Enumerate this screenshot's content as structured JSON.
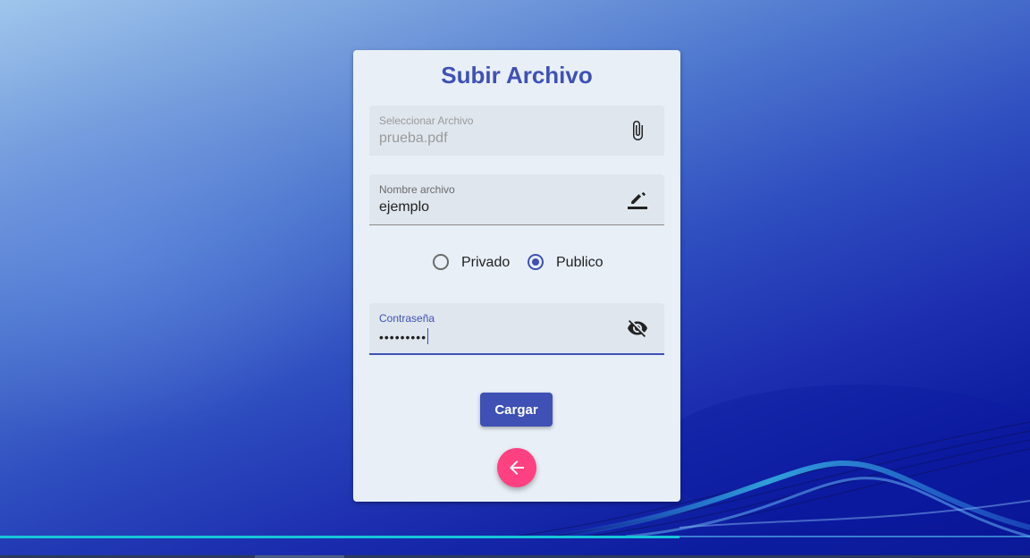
{
  "colors": {
    "primary": "#3f51b5",
    "accent": "#ff4081",
    "card_bg": "#e8eff7",
    "field_bg": "#dfe6ee"
  },
  "dialog": {
    "title": "Subir Archivo",
    "file_field": {
      "label": "Seleccionar Archivo",
      "value": "prueba.pdf",
      "icon": "paperclip-icon",
      "disabled": true
    },
    "name_field": {
      "label": "Nombre archivo",
      "value": "ejemplo",
      "icon": "pencil-icon"
    },
    "visibility": {
      "options": [
        {
          "label": "Privado",
          "checked": false
        },
        {
          "label": "Publico",
          "checked": true
        }
      ]
    },
    "password_field": {
      "label": "Contraseña",
      "value": "•••••••••",
      "icon": "eye-off-icon",
      "focused": true
    },
    "submit_label": "Cargar",
    "back_icon": "arrow-left-icon"
  }
}
